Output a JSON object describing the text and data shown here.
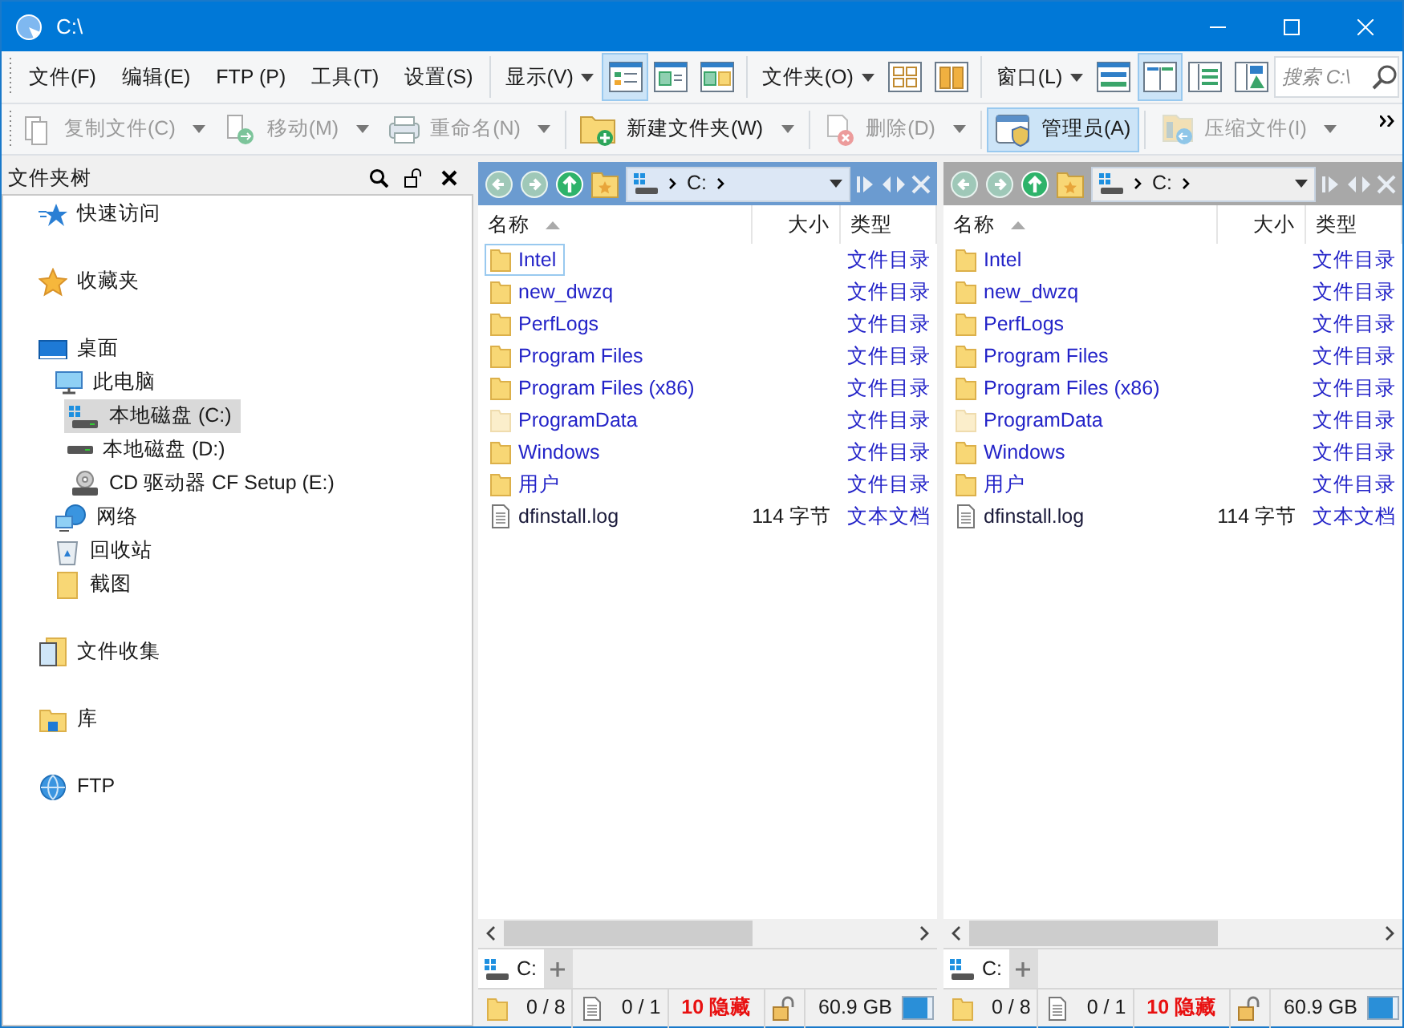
{
  "window": {
    "title": "C:\\"
  },
  "menus": [
    "文件(F)",
    "编辑(E)",
    "FTP (P)",
    "工具(T)",
    "设置(S)"
  ],
  "menu_groups": [
    {
      "label": "显示(V)",
      "buttons": [
        {
          "kind": "details",
          "selected": true
        },
        {
          "kind": "preview",
          "selected": false
        },
        {
          "kind": "thumbs",
          "selected": false
        }
      ]
    },
    {
      "label": "文件夹(O)",
      "buttons": [
        {
          "kind": "grid",
          "selected": false
        },
        {
          "kind": "columns",
          "selected": false
        }
      ]
    },
    {
      "label": "窗口(L)",
      "buttons": [
        {
          "kind": "single",
          "selected": false
        },
        {
          "kind": "dual",
          "selected": true
        },
        {
          "kind": "tree",
          "selected": false
        },
        {
          "kind": "viewer",
          "selected": false
        }
      ]
    }
  ],
  "search": {
    "placeholder": "搜索 C:\\"
  },
  "toolbar": [
    {
      "kind": "copy",
      "label": "复制文件(C)",
      "disabled": true,
      "on": false
    },
    {
      "kind": "move",
      "label": "移动(M)",
      "disabled": true,
      "on": false
    },
    {
      "kind": "rename",
      "label": "重命名(N)",
      "disabled": true,
      "on": false
    },
    {
      "kind": "newfolder",
      "label": "新建文件夹(W)",
      "disabled": false,
      "on": false
    },
    {
      "kind": "delete",
      "label": "删除(D)",
      "disabled": true,
      "on": false
    },
    {
      "kind": "admin",
      "label": "管理员(A)",
      "disabled": false,
      "on": true
    },
    {
      "kind": "compress",
      "label": "压缩文件(I)",
      "disabled": true,
      "on": false
    }
  ],
  "folder_tree": {
    "title": "文件夹树",
    "items": [
      {
        "kind": "quick",
        "label": "快速访问",
        "selected": false
      },
      {
        "kind": "favorites",
        "label": "收藏夹",
        "selected": false
      },
      {
        "kind": "desktop",
        "label": "桌面",
        "selected": false,
        "children": [
          {
            "kind": "computer",
            "label": "此电脑",
            "selected": false,
            "children": [
              {
                "kind": "systemdrive",
                "label": "本地磁盘 (C:)",
                "selected": true
              },
              {
                "kind": "drive",
                "label": "本地磁盘 (D:)",
                "selected": false
              },
              {
                "kind": "cdrom",
                "label": "CD 驱动器 CF Setup (E:)",
                "selected": false
              }
            ]
          },
          {
            "kind": "network",
            "label": "网络",
            "selected": false
          },
          {
            "kind": "recycle",
            "label": "回收站",
            "selected": false
          },
          {
            "kind": "folder",
            "label": "截图",
            "selected": false
          }
        ]
      },
      {
        "kind": "collection",
        "label": "文件收集",
        "selected": false
      },
      {
        "kind": "library",
        "label": "库",
        "selected": false
      },
      {
        "kind": "ftp",
        "label": "FTP",
        "selected": false
      }
    ]
  },
  "panes": [
    {
      "active": true,
      "path": "C:",
      "columns": [
        {
          "label": "名称",
          "sorted": true
        },
        {
          "label": "大小",
          "sorted": false
        },
        {
          "label": "类型",
          "sorted": false
        }
      ],
      "rows": [
        {
          "kind": "folder",
          "name": "Intel",
          "type": "文件目录",
          "hidden": false,
          "focused": true
        },
        {
          "kind": "folder",
          "name": "new_dwzq",
          "type": "文件目录",
          "hidden": false,
          "focused": false
        },
        {
          "kind": "folder",
          "name": "PerfLogs",
          "type": "文件目录",
          "hidden": false,
          "focused": false
        },
        {
          "kind": "folder",
          "name": "Program Files",
          "type": "文件目录",
          "hidden": false,
          "focused": false
        },
        {
          "kind": "folder",
          "name": "Program Files (x86)",
          "type": "文件目录",
          "hidden": false,
          "focused": false
        },
        {
          "kind": "folder",
          "name": "ProgramData",
          "type": "文件目录",
          "hidden": true,
          "focused": false
        },
        {
          "kind": "folder",
          "name": "Windows",
          "type": "文件目录",
          "hidden": false,
          "focused": false
        },
        {
          "kind": "folder",
          "name": "用户",
          "type": "文件目录",
          "hidden": false,
          "focused": false
        },
        {
          "kind": "file",
          "name": "dfinstall.log",
          "size": "114 字节",
          "type": "文本文档",
          "hidden": false,
          "focused": false
        }
      ],
      "tabs": [
        {
          "label": "C:",
          "selected": true
        }
      ],
      "status": {
        "folders": "0 / 8",
        "files": "0 / 1",
        "hidden_count": "10 隐藏",
        "free": "60.9 GB",
        "level": 0.85
      }
    },
    {
      "active": false,
      "path": "C:",
      "columns": [
        {
          "label": "名称",
          "sorted": true
        },
        {
          "label": "大小",
          "sorted": false
        },
        {
          "label": "类型",
          "sorted": false
        }
      ],
      "rows": [
        {
          "kind": "folder",
          "name": "Intel",
          "type": "文件目录",
          "hidden": false,
          "focused": false
        },
        {
          "kind": "folder",
          "name": "new_dwzq",
          "type": "文件目录",
          "hidden": false,
          "focused": false
        },
        {
          "kind": "folder",
          "name": "PerfLogs",
          "type": "文件目录",
          "hidden": false,
          "focused": false
        },
        {
          "kind": "folder",
          "name": "Program Files",
          "type": "文件目录",
          "hidden": false,
          "focused": false
        },
        {
          "kind": "folder",
          "name": "Program Files (x86)",
          "type": "文件目录",
          "hidden": false,
          "focused": false
        },
        {
          "kind": "folder",
          "name": "ProgramData",
          "type": "文件目录",
          "hidden": true,
          "focused": false
        },
        {
          "kind": "folder",
          "name": "Windows",
          "type": "文件目录",
          "hidden": false,
          "focused": false
        },
        {
          "kind": "folder",
          "name": "用户",
          "type": "文件目录",
          "hidden": false,
          "focused": false
        },
        {
          "kind": "file",
          "name": "dfinstall.log",
          "size": "114 字节",
          "type": "文本文档",
          "hidden": false,
          "focused": false
        }
      ],
      "tabs": [
        {
          "label": "C:",
          "selected": true
        }
      ],
      "status": {
        "folders": "0 / 8",
        "files": "0 / 1",
        "hidden_count": "10 隐藏",
        "free": "60.9 GB",
        "level": 0.85
      }
    }
  ]
}
